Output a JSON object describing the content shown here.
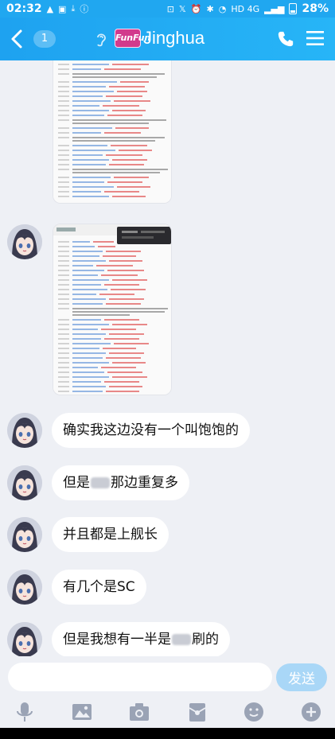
{
  "status_bar": {
    "time": "02:32",
    "network": "HD 4G",
    "battery": "28%"
  },
  "header": {
    "unread_count": "1",
    "logo_text": "FunFun",
    "contact_name": "Jinghua"
  },
  "messages": [
    {
      "type": "image",
      "sender": "contact",
      "description": "screenshot"
    },
    {
      "type": "image",
      "sender": "contact",
      "description": "screenshot"
    },
    {
      "type": "text",
      "sender": "contact",
      "text": "确实我这边没有一个叫饱饱的"
    },
    {
      "type": "text",
      "sender": "contact",
      "text_before": "但是",
      "text_after": "那边重复多"
    },
    {
      "type": "text",
      "sender": "contact",
      "text": "并且都是上舰长"
    },
    {
      "type": "text",
      "sender": "contact",
      "text": "有几个是SC"
    },
    {
      "type": "text",
      "sender": "contact",
      "text_before": "但是我想有一半是",
      "text_after": "刷的"
    }
  ],
  "input": {
    "value": "",
    "placeholder": "",
    "send_label": "发送"
  },
  "colors": {
    "accent": "#20a7f0",
    "send_disabled": "#a9d7f7",
    "chat_bg": "#eef0f5"
  },
  "toolbar_icons": [
    "mic-icon",
    "image-icon",
    "camera-icon",
    "red-packet-icon",
    "emoji-icon",
    "plus-icon"
  ]
}
